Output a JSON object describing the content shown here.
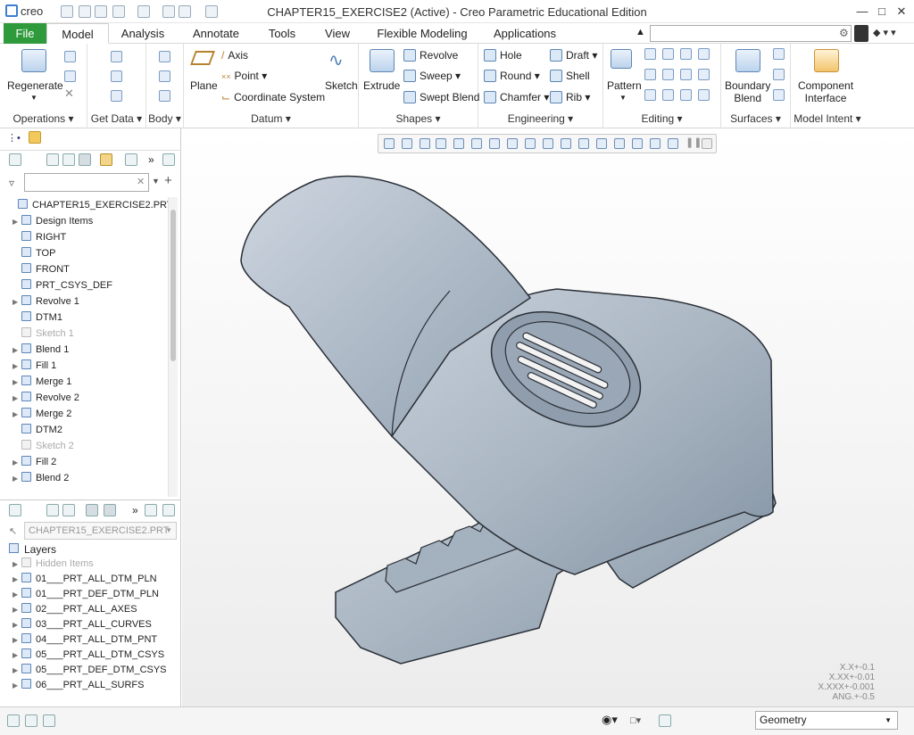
{
  "window": {
    "app_logo": "creo",
    "title": "CHAPTER15_EXERCISE2 (Active) - Creo Parametric Educational Edition"
  },
  "menu": {
    "tabs": [
      "File",
      "Model",
      "Analysis",
      "Annotate",
      "Tools",
      "View",
      "Flexible Modeling",
      "Applications"
    ]
  },
  "ribbon": {
    "operations": {
      "regenerate": "Regenerate",
      "label": "Operations"
    },
    "get_data": {
      "label": "Get Data"
    },
    "body": {
      "label": "Body"
    },
    "datum": {
      "plane": "Plane",
      "axis": "Axis",
      "point": "Point",
      "csys": "Coordinate System",
      "sketch": "Sketch",
      "label": "Datum"
    },
    "shapes": {
      "extrude": "Extrude",
      "revolve": "Revolve",
      "sweep": "Sweep",
      "swept_blend": "Swept Blend",
      "label": "Shapes"
    },
    "engineering": {
      "hole": "Hole",
      "round": "Round",
      "chamfer": "Chamfer",
      "draft": "Draft",
      "shell": "Shell",
      "rib": "Rib",
      "label": "Engineering"
    },
    "editing": {
      "pattern": "Pattern",
      "label": "Editing"
    },
    "surfaces": {
      "boundary_blend_1": "Boundary",
      "boundary_blend_2": "Blend",
      "label": "Surfaces"
    },
    "model_intent": {
      "component_1": "Component",
      "component_2": "Interface",
      "label": "Model Intent"
    }
  },
  "model_tree": {
    "items": [
      {
        "label": "CHAPTER15_EXERCISE2.PRT",
        "dim": false
      },
      {
        "label": "Design Items",
        "dim": false
      },
      {
        "label": "RIGHT",
        "dim": false
      },
      {
        "label": "TOP",
        "dim": false
      },
      {
        "label": "FRONT",
        "dim": false
      },
      {
        "label": "PRT_CSYS_DEF",
        "dim": false
      },
      {
        "label": "Revolve 1",
        "dim": false
      },
      {
        "label": "DTM1",
        "dim": false
      },
      {
        "label": "Sketch 1",
        "dim": true
      },
      {
        "label": "Blend 1",
        "dim": false
      },
      {
        "label": "Fill 1",
        "dim": false
      },
      {
        "label": "Merge 1",
        "dim": false
      },
      {
        "label": "Revolve 2",
        "dim": false
      },
      {
        "label": "Merge 2",
        "dim": false
      },
      {
        "label": "DTM2",
        "dim": false
      },
      {
        "label": "Sketch 2",
        "dim": true
      },
      {
        "label": "Fill 2",
        "dim": false
      },
      {
        "label": "Blend 2",
        "dim": false
      }
    ]
  },
  "layer_tree": {
    "model_select": "CHAPTER15_EXERCISE2.PRT",
    "root": "Layers",
    "items": [
      {
        "label": "Hidden Items",
        "dim": true
      },
      {
        "label": "01___PRT_ALL_DTM_PLN",
        "dim": false
      },
      {
        "label": "01___PRT_DEF_DTM_PLN",
        "dim": false
      },
      {
        "label": "02___PRT_ALL_AXES",
        "dim": false
      },
      {
        "label": "03___PRT_ALL_CURVES",
        "dim": false
      },
      {
        "label": "04___PRT_ALL_DTM_PNT",
        "dim": false
      },
      {
        "label": "05___PRT_ALL_DTM_CSYS",
        "dim": false
      },
      {
        "label": "05___PRT_DEF_DTM_CSYS",
        "dim": false
      },
      {
        "label": "06___PRT_ALL_SURFS",
        "dim": false
      }
    ]
  },
  "tolerances": [
    "X.X+-0.1",
    "X.XX+-0.01",
    "X.XXX+-0.001",
    "ANG.+-0.5"
  ],
  "status": {
    "filter": "Geometry"
  },
  "colors": {
    "file_tab": "#2f9a3b",
    "model_body": "#aab7c4",
    "accent": "#3c7fd1"
  }
}
